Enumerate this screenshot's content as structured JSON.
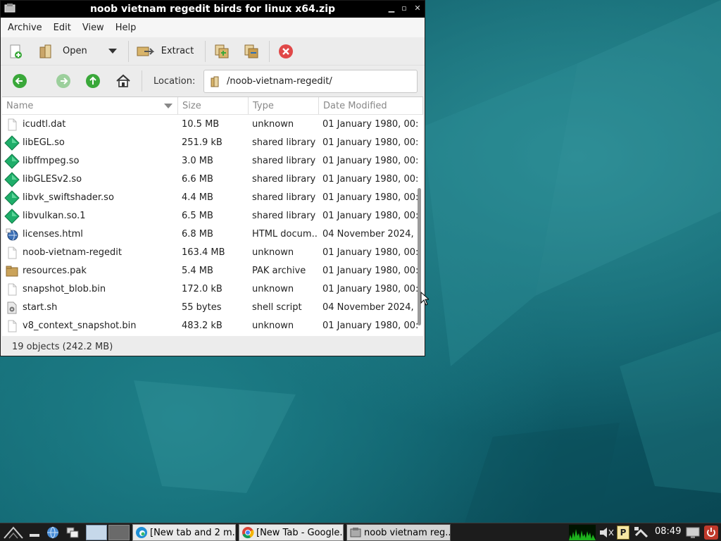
{
  "window": {
    "title": "noob vietnam regedit birds for linux x64.zip",
    "controls": {
      "minimize": "▁",
      "maximize": "▫",
      "close": "✕"
    }
  },
  "menu": [
    "Archive",
    "Edit",
    "View",
    "Help"
  ],
  "toolbar": {
    "open_label": "Open",
    "extract_label": "Extract"
  },
  "location": {
    "label": "Location:",
    "path": "/noob-vietnam-regedit/"
  },
  "columns": [
    "Name",
    "Size",
    "Type",
    "Date Modified"
  ],
  "files": [
    {
      "name": "icudtl.dat",
      "size": "10.5 MB",
      "type": "unknown",
      "date": "01 January 1980, 00:...",
      "icon": "file-icon"
    },
    {
      "name": "libEGL.so",
      "size": "251.9 kB",
      "type": "shared library",
      "date": "01 January 1980, 00:...",
      "icon": "shared-library-icon"
    },
    {
      "name": "libffmpeg.so",
      "size": "3.0 MB",
      "type": "shared library",
      "date": "01 January 1980, 00:...",
      "icon": "shared-library-icon"
    },
    {
      "name": "libGLESv2.so",
      "size": "6.6 MB",
      "type": "shared library",
      "date": "01 January 1980, 00:...",
      "icon": "shared-library-icon"
    },
    {
      "name": "libvk_swiftshader.so",
      "size": "4.4 MB",
      "type": "shared library",
      "date": "01 January 1980, 00:...",
      "icon": "shared-library-icon"
    },
    {
      "name": "libvulkan.so.1",
      "size": "6.5 MB",
      "type": "shared library",
      "date": "01 January 1980, 00:...",
      "icon": "shared-library-icon"
    },
    {
      "name": "licenses.html",
      "size": "6.8 MB",
      "type": "HTML docum...",
      "date": "04 November 2024, ...",
      "icon": "html-file-icon"
    },
    {
      "name": "noob-vietnam-regedit",
      "size": "163.4 MB",
      "type": "unknown",
      "date": "01 January 1980, 00:...",
      "icon": "file-icon"
    },
    {
      "name": "resources.pak",
      "size": "5.4 MB",
      "type": "PAK archive",
      "date": "01 January 1980, 00:...",
      "icon": "archive-icon"
    },
    {
      "name": "snapshot_blob.bin",
      "size": "172.0 kB",
      "type": "unknown",
      "date": "01 January 1980, 00:...",
      "icon": "file-icon"
    },
    {
      "name": "start.sh",
      "size": "55 bytes",
      "type": "shell script",
      "date": "04 November 2024, ...",
      "icon": "script-icon"
    },
    {
      "name": "v8_context_snapshot.bin",
      "size": "483.2 kB",
      "type": "unknown",
      "date": "01 January 1980, 00:...",
      "icon": "file-icon"
    }
  ],
  "status": "19 objects (242.2 MB)",
  "taskbar": {
    "tasks": [
      {
        "label": "[New tab and 2 m...",
        "icon": "edge-icon"
      },
      {
        "label": "[New Tab - Google...",
        "icon": "chrome-icon"
      },
      {
        "label": "noob vietnam reg...",
        "icon": "archive-manager-icon"
      }
    ],
    "tray_badge": "P",
    "clock": "08:49"
  },
  "colors": {
    "shared_library": "#1fae6a",
    "stop": "#e04848",
    "nav_green": "#3aa83a",
    "desktop": "#0f5f6b"
  }
}
